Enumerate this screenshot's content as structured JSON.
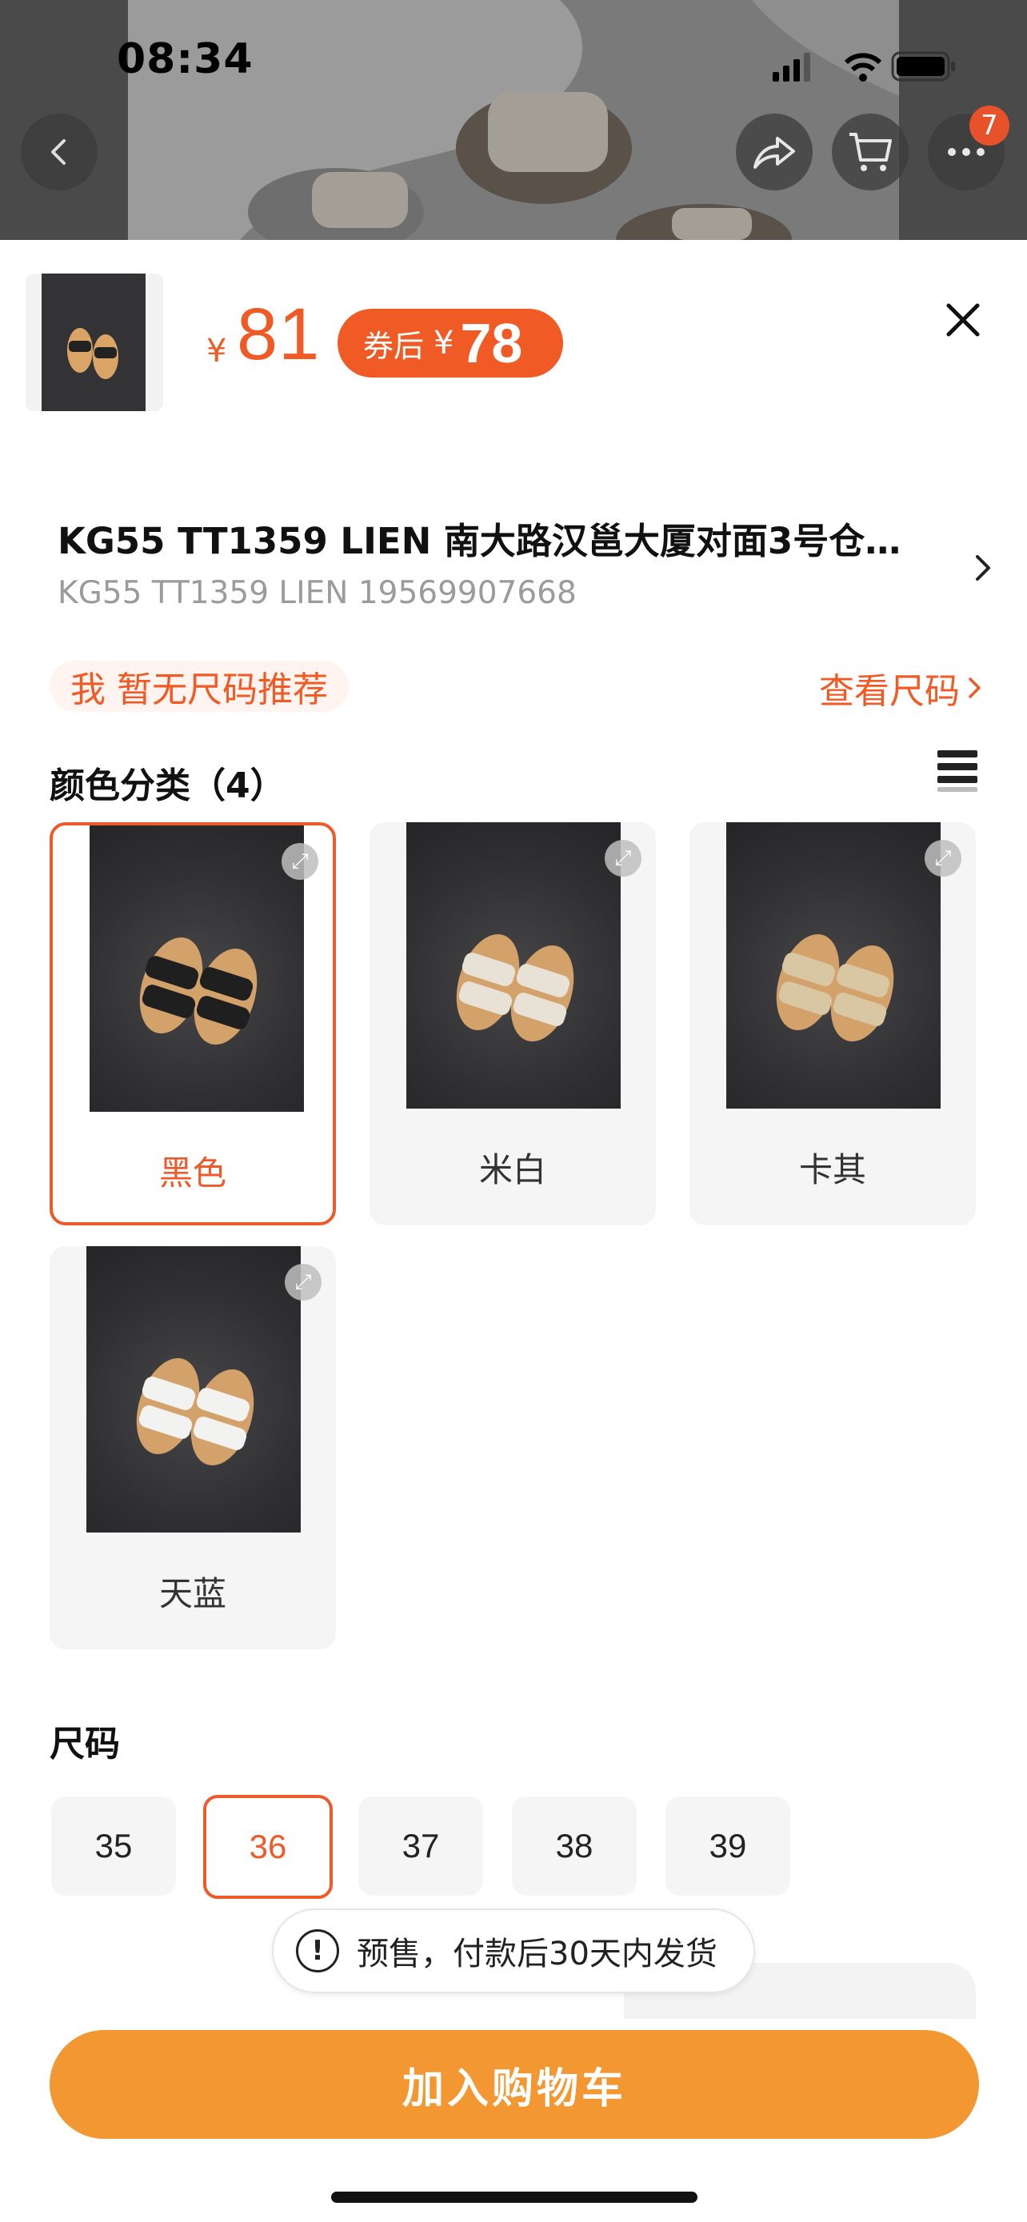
{
  "status_bar": {
    "time": "08:34"
  },
  "nav": {
    "cart_badge": "7"
  },
  "product": {
    "price_symbol": "¥",
    "price": "81",
    "coupon_label": "券后",
    "coupon_symbol": "¥",
    "coupon_price": "78"
  },
  "address": {
    "line1": "KG55 TT1359 LIEN  南大路汉邕大厦对面3号仓…",
    "line2": "KG55 TT1359 LIEN 19569907668"
  },
  "size_recommend": {
    "text": "我 暂无尺码推荐",
    "view_size": "查看尺码"
  },
  "color_section": {
    "title": "颜色分类（4）",
    "options": [
      {
        "label": "黑色",
        "selected": true
      },
      {
        "label": "米白",
        "selected": false
      },
      {
        "label": "卡其",
        "selected": false
      },
      {
        "label": "天蓝",
        "selected": false
      }
    ]
  },
  "size_section": {
    "title": "尺码",
    "options": [
      {
        "label": "35",
        "selected": false
      },
      {
        "label": "36",
        "selected": true
      },
      {
        "label": "37",
        "selected": false
      },
      {
        "label": "38",
        "selected": false
      },
      {
        "label": "39",
        "selected": false
      }
    ]
  },
  "toast": {
    "icon": "!",
    "text": "预售，付款后30天内发货"
  },
  "actions": {
    "add_to_cart": "加入购物车"
  },
  "colors": {
    "accent": "#f05a24",
    "cart_button": "#f29732"
  }
}
